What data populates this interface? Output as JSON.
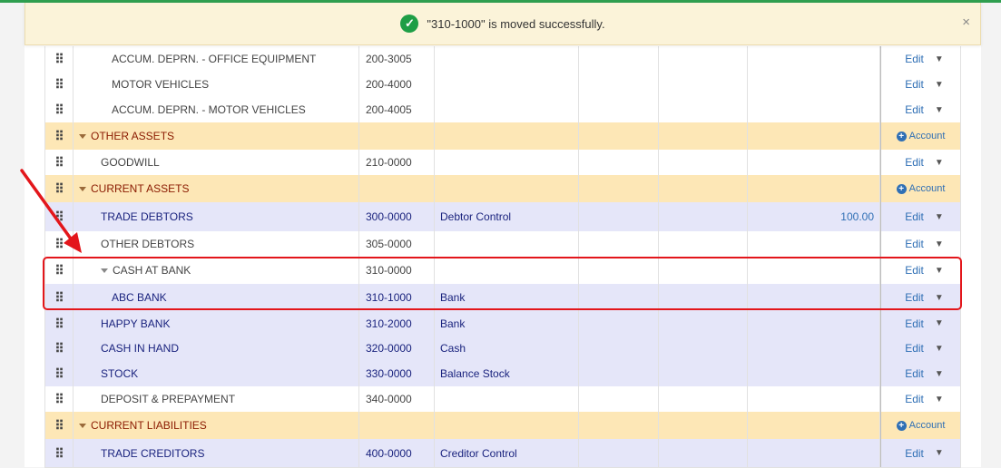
{
  "toast": {
    "message": "\"310-1000\" is moved successfully.",
    "close": "×"
  },
  "actions": {
    "edit": "Edit",
    "account": "Account",
    "chevron": "⌄"
  },
  "colors": {
    "group_row": "#fde7b6",
    "blue_row": "#e5e6f9",
    "highlight": "#e3161b",
    "link": "#2f6fb5"
  },
  "rows": [
    {
      "name": "ACCUM. DEPRN. - OFFICE EQUIPMENT",
      "code": "200-3005",
      "type": "",
      "amount": "",
      "kind": "white",
      "indent": 2,
      "action": "edit"
    },
    {
      "name": "MOTOR VEHICLES",
      "code": "200-4000",
      "type": "",
      "amount": "",
      "kind": "white",
      "indent": 2,
      "action": "edit"
    },
    {
      "name": "ACCUM. DEPRN. - MOTOR VEHICLES",
      "code": "200-4005",
      "type": "",
      "amount": "",
      "kind": "white",
      "indent": 2,
      "action": "edit"
    },
    {
      "name": "OTHER ASSETS",
      "code": "",
      "type": "",
      "amount": "",
      "kind": "group",
      "indent": 0,
      "action": "account"
    },
    {
      "name": "GOODWILL",
      "code": "210-0000",
      "type": "",
      "amount": "",
      "kind": "white",
      "indent": 1,
      "action": "edit"
    },
    {
      "name": "CURRENT ASSETS",
      "code": "",
      "type": "",
      "amount": "",
      "kind": "group",
      "indent": 0,
      "action": "account"
    },
    {
      "name": "TRADE DEBTORS",
      "code": "300-0000",
      "type": "Debtor Control",
      "amount": "100.00",
      "kind": "blue",
      "indent": 1,
      "action": "edit"
    },
    {
      "name": "OTHER DEBTORS",
      "code": "305-0000",
      "type": "",
      "amount": "",
      "kind": "white",
      "indent": 1,
      "action": "edit"
    },
    {
      "name": "CASH AT BANK",
      "code": "310-0000",
      "type": "",
      "amount": "",
      "kind": "white",
      "indent": 1,
      "caret": true,
      "action": "edit"
    },
    {
      "name": "ABC BANK",
      "code": "310-1000",
      "type": "Bank",
      "amount": "",
      "kind": "blue",
      "indent": 2,
      "action": "edit"
    },
    {
      "name": "HAPPY BANK",
      "code": "310-2000",
      "type": "Bank",
      "amount": "",
      "kind": "blue",
      "indent": 1,
      "action": "edit"
    },
    {
      "name": "CASH IN HAND",
      "code": "320-0000",
      "type": "Cash",
      "amount": "",
      "kind": "blue",
      "indent": 1,
      "action": "edit"
    },
    {
      "name": "STOCK",
      "code": "330-0000",
      "type": "Balance Stock",
      "amount": "",
      "kind": "blue",
      "indent": 1,
      "action": "edit"
    },
    {
      "name": "DEPOSIT & PREPAYMENT",
      "code": "340-0000",
      "type": "",
      "amount": "",
      "kind": "white",
      "indent": 1,
      "action": "edit"
    },
    {
      "name": "CURRENT LIABILITIES",
      "code": "",
      "type": "",
      "amount": "",
      "kind": "group",
      "indent": 0,
      "action": "account"
    },
    {
      "name": "TRADE CREDITORS",
      "code": "400-0000",
      "type": "Creditor Control",
      "amount": "",
      "kind": "blue",
      "indent": 1,
      "action": "edit"
    }
  ]
}
